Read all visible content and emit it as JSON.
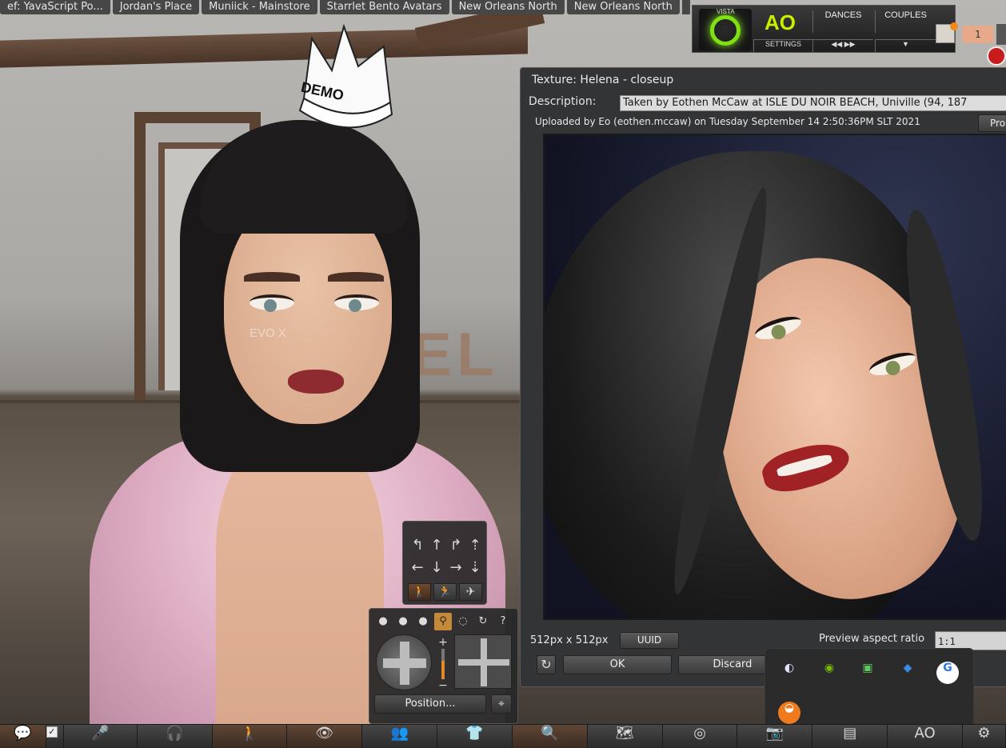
{
  "tabs": [
    "ef: YavaScript Po...",
    "Jordan's Place",
    "Muniick - Mainstore",
    "Starrlet Bento Avatars",
    "New Orleans North",
    "New Orleans North"
  ],
  "scene": {
    "crown_text": "DEMO",
    "makeup_brand": "EVO X",
    "wall_letters": "LEL"
  },
  "ao_hud": {
    "brand": "VISTA",
    "title": "AO",
    "dances_label": "DANCES",
    "couples_label": "COUPLES",
    "settings_label": "SETTINGS",
    "prev_icon": "rewind-icon",
    "next_icon": "fast-forward-icon",
    "menu_icon": "menu-icon",
    "power_color": "#7fe014"
  },
  "notification_count": "1",
  "texture_floater": {
    "title": "Texture: Helena - closeup",
    "description_label": "Description:",
    "description_value": "Taken by Eothen McCaw at ISLE DU NOIR BEACH, Univille (94, 187",
    "uploaded_text": "Uploaded by Eo (eothen.mccaw) on Tuesday September 14 2:50:36PM SLT 2021",
    "profile_button": "Pro",
    "size_text": "512px x 512px",
    "uuid_button": "UUID",
    "aspect_label": "Preview aspect ratio",
    "aspect_value": "1:1",
    "ok_button": "OK",
    "discard_button": "Discard"
  },
  "camera_panel": {
    "position_button": "Position...",
    "help": "?"
  },
  "tray_items": [
    {
      "name": "discord",
      "glyph": "◐",
      "color": "#5865f2"
    },
    {
      "name": "nvidia",
      "glyph": "◉",
      "color": "#76b900"
    },
    {
      "name": "gpu-monitor",
      "glyph": "▣",
      "color": "#3aa23a"
    },
    {
      "name": "windows-security",
      "glyph": "◆",
      "color": "#1f6fd0"
    },
    {
      "name": "sync-app",
      "glyph": "G",
      "color": "#2a7be4"
    },
    {
      "name": "orange-app",
      "glyph": "◒",
      "color": "#f07a1e"
    }
  ],
  "toolbar": [
    "chat",
    "check",
    "mic",
    "headphones",
    "walk",
    "view",
    "people",
    "appearance",
    "search",
    "map",
    "radar",
    "snapshot",
    "inventory",
    "ao",
    "settings"
  ]
}
